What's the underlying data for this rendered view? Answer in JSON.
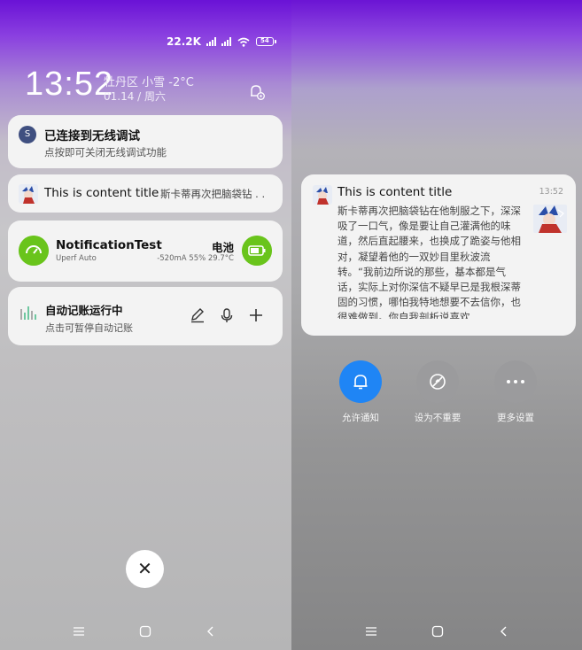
{
  "status_bar": {
    "speed": "22.2K",
    "battery": "54"
  },
  "lockscreen": {
    "time": "13:52",
    "location_weather": "牡丹区 小雪 -2°C",
    "date": "01.14 / 周六"
  },
  "notifications": {
    "wireless_debug": {
      "title": "已连接到无线调试",
      "subtitle": "点按即可关闭无线调试功能",
      "icon_text": "S"
    },
    "content_notif": {
      "title": "This is content title",
      "preview": "斯卡蒂再次把脑袋钻 . ."
    },
    "notification_test": {
      "app": "NotificationTest",
      "app_sub": "Uperf Auto",
      "battery_label": "电池",
      "battery_stats": "-520mA 55% 29.7°C"
    },
    "auto_accounting": {
      "title": "自动记账运行中",
      "subtitle": "点击可暂停自动记账"
    }
  },
  "expanded": {
    "title": "This is content title",
    "time": "13:52",
    "body": "斯卡蒂再次把脑袋钻在他制服之下，深深吸了一口气，像是要让自己灌满他的味道，然后直起腰来，也换成了跪姿与他相对，凝望着他的一双妙目里秋波流转。“我前边所说的那些，基本都是气话，实际上对你深信不疑早已是我根深蒂固的习惯，哪怕我特地想要不去信你，也很难做到。你自我剖析说喜欢..."
  },
  "actions": [
    {
      "label": "允许通知"
    },
    {
      "label": "设为不重要"
    },
    {
      "label": "更多设置"
    }
  ],
  "colors": {
    "accent_blue": "#1f85f5",
    "green": "#69c41b",
    "debug_icon": "#3f4f80"
  }
}
